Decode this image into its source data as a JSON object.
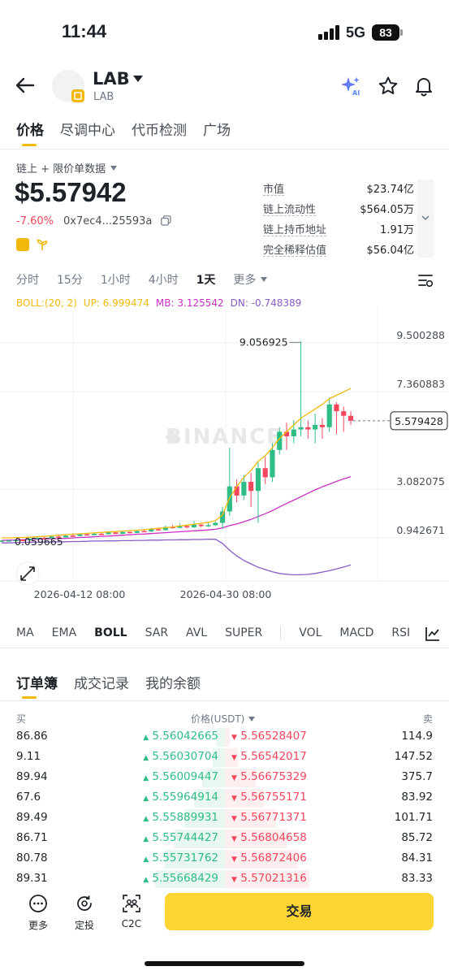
{
  "status": {
    "time": "11:44",
    "network": "5G",
    "battery": "83"
  },
  "token": {
    "name": "LAB",
    "subtitle": "LAB"
  },
  "tabs": [
    "价格",
    "尽调中心",
    "代币检测",
    "广场"
  ],
  "price_area": {
    "data_source": "链上 + 限价单数据",
    "price": "$5.57942",
    "change": "-7.60%",
    "address": "0x7ec4...25593a",
    "stats": [
      {
        "label": "市值",
        "value": "$23.74亿"
      },
      {
        "label": "链上流动性",
        "value": "$564.05万"
      },
      {
        "label": "链上持币地址",
        "value": "1.91万"
      },
      {
        "label": "完全稀释估值",
        "value": "$56.04亿"
      }
    ]
  },
  "intervals": [
    "分时",
    "15分",
    "1小时",
    "4小时",
    "1天",
    "更多"
  ],
  "boll": {
    "label": "BOLL:(20, 2)",
    "up": "UP: 6.999474",
    "mb": "MB: 3.125542",
    "dn": "DN: -0.748389"
  },
  "chart_data": {
    "type": "candlestick",
    "y_ticks": [
      "9.500288",
      "7.360883",
      "3.082075",
      "0.942671"
    ],
    "x_ticks": [
      "2026-04-12 08:00",
      "2026-04-30 08:00"
    ],
    "high_label": "9.056925",
    "low_label": "0.059665",
    "current_price_label": "5.579428",
    "watermark": "BINANCE",
    "ylim": [
      -1.2,
      10.5
    ],
    "candles": [
      {
        "o": 0.3,
        "c": 0.32,
        "h": 0.34,
        "l": 0.29
      },
      {
        "o": 0.32,
        "c": 0.33,
        "h": 0.36,
        "l": 0.3
      },
      {
        "o": 0.33,
        "c": 0.35,
        "h": 0.37,
        "l": 0.31
      },
      {
        "o": 0.35,
        "c": 0.34,
        "h": 0.38,
        "l": 0.32
      },
      {
        "o": 0.34,
        "c": 0.4,
        "h": 0.43,
        "l": 0.33
      },
      {
        "o": 0.4,
        "c": 0.44,
        "h": 0.48,
        "l": 0.38
      },
      {
        "o": 0.44,
        "c": 0.42,
        "h": 0.5,
        "l": 0.4
      },
      {
        "o": 0.42,
        "c": 0.5,
        "h": 0.54,
        "l": 0.41
      },
      {
        "o": 0.5,
        "c": 0.46,
        "h": 0.55,
        "l": 0.44
      },
      {
        "o": 0.46,
        "c": 0.54,
        "h": 0.58,
        "l": 0.45
      },
      {
        "o": 0.54,
        "c": 0.52,
        "h": 0.64,
        "l": 0.5
      },
      {
        "o": 0.52,
        "c": 0.6,
        "h": 0.64,
        "l": 0.51
      },
      {
        "o": 0.6,
        "c": 0.56,
        "h": 0.62,
        "l": 0.54
      },
      {
        "o": 0.56,
        "c": 0.62,
        "h": 0.66,
        "l": 0.55
      },
      {
        "o": 0.62,
        "c": 0.6,
        "h": 0.7,
        "l": 0.57
      },
      {
        "o": 0.6,
        "c": 0.68,
        "h": 0.72,
        "l": 0.59
      },
      {
        "o": 0.68,
        "c": 0.62,
        "h": 0.7,
        "l": 0.6
      },
      {
        "o": 0.62,
        "c": 0.7,
        "h": 0.74,
        "l": 0.61
      },
      {
        "o": 0.7,
        "c": 0.66,
        "h": 0.76,
        "l": 0.64
      },
      {
        "o": 0.66,
        "c": 0.74,
        "h": 0.78,
        "l": 0.65
      },
      {
        "o": 0.74,
        "c": 0.72,
        "h": 0.8,
        "l": 0.69
      },
      {
        "o": 0.72,
        "c": 0.82,
        "h": 0.88,
        "l": 0.7
      },
      {
        "o": 0.82,
        "c": 0.78,
        "h": 0.9,
        "l": 0.75
      },
      {
        "o": 0.78,
        "c": 0.92,
        "h": 0.98,
        "l": 0.77
      },
      {
        "o": 0.92,
        "c": 0.88,
        "h": 1.0,
        "l": 0.85
      },
      {
        "o": 0.88,
        "c": 0.96,
        "h": 1.08,
        "l": 0.86
      },
      {
        "o": 0.96,
        "c": 0.9,
        "h": 1.02,
        "l": 0.86
      },
      {
        "o": 0.9,
        "c": 1.02,
        "h": 1.18,
        "l": 0.88
      },
      {
        "o": 1.02,
        "c": 0.96,
        "h": 1.06,
        "l": 0.9
      },
      {
        "o": 0.96,
        "c": 1.0,
        "h": 1.1,
        "l": 0.92
      },
      {
        "o": 1.0,
        "c": 1.1,
        "h": 1.16,
        "l": 0.96
      },
      {
        "o": 1.1,
        "c": 1.6,
        "h": 1.8,
        "l": 0.86
      },
      {
        "o": 1.6,
        "c": 2.7,
        "h": 4.4,
        "l": 1.4
      },
      {
        "o": 2.7,
        "c": 2.3,
        "h": 3.0,
        "l": 2.0
      },
      {
        "o": 2.3,
        "c": 2.9,
        "h": 3.2,
        "l": 2.1
      },
      {
        "o": 2.9,
        "c": 2.5,
        "h": 3.3,
        "l": 1.8
      },
      {
        "o": 2.5,
        "c": 3.5,
        "h": 3.8,
        "l": 1.1
      },
      {
        "o": 3.5,
        "c": 3.1,
        "h": 4.0,
        "l": 2.8
      },
      {
        "o": 3.1,
        "c": 4.3,
        "h": 4.6,
        "l": 2.9
      },
      {
        "o": 4.3,
        "c": 5.1,
        "h": 5.3,
        "l": 4.1
      },
      {
        "o": 5.1,
        "c": 4.9,
        "h": 5.5,
        "l": 4.3
      },
      {
        "o": 4.9,
        "c": 5.2,
        "h": 5.6,
        "l": 4.6
      },
      {
        "o": 5.2,
        "c": 5.3,
        "h": 9.06,
        "l": 4.9
      },
      {
        "o": 5.3,
        "c": 5.2,
        "h": 5.6,
        "l": 4.8
      },
      {
        "o": 5.2,
        "c": 5.4,
        "h": 5.9,
        "l": 4.6
      },
      {
        "o": 5.4,
        "c": 5.3,
        "h": 5.7,
        "l": 4.8
      },
      {
        "o": 5.3,
        "c": 6.3,
        "h": 6.6,
        "l": 5.1
      },
      {
        "o": 6.3,
        "c": 6.0,
        "h": 6.4,
        "l": 5.0
      },
      {
        "o": 6.0,
        "c": 5.8,
        "h": 6.2,
        "l": 5.1
      },
      {
        "o": 5.8,
        "c": 5.58,
        "h": 6.0,
        "l": 5.4
      }
    ],
    "boll_up": [
      0.44,
      0.44,
      0.45,
      0.46,
      0.47,
      0.49,
      0.51,
      0.53,
      0.56,
      0.58,
      0.6,
      0.62,
      0.64,
      0.66,
      0.68,
      0.7,
      0.72,
      0.74,
      0.76,
      0.78,
      0.8,
      0.83,
      0.86,
      0.89,
      0.92,
      0.96,
      1.0,
      1.04,
      1.08,
      1.12,
      1.2,
      1.45,
      2.2,
      2.7,
      3.1,
      3.4,
      3.8,
      4.05,
      4.4,
      4.8,
      5.1,
      5.4,
      5.7,
      5.9,
      6.1,
      6.3,
      6.55,
      6.7,
      6.85,
      7.0
    ],
    "boll_mb": [
      0.33,
      0.34,
      0.35,
      0.36,
      0.37,
      0.38,
      0.39,
      0.4,
      0.41,
      0.42,
      0.44,
      0.46,
      0.47,
      0.49,
      0.51,
      0.52,
      0.54,
      0.56,
      0.58,
      0.6,
      0.61,
      0.63,
      0.65,
      0.67,
      0.69,
      0.71,
      0.73,
      0.75,
      0.77,
      0.79,
      0.82,
      0.88,
      0.98,
      1.05,
      1.15,
      1.25,
      1.38,
      1.5,
      1.64,
      1.8,
      1.95,
      2.1,
      2.25,
      2.4,
      2.55,
      2.68,
      2.8,
      2.92,
      3.03,
      3.13
    ],
    "boll_dn": [
      0.22,
      0.22,
      0.23,
      0.24,
      0.25,
      0.25,
      0.26,
      0.26,
      0.27,
      0.27,
      0.28,
      0.28,
      0.29,
      0.3,
      0.3,
      0.31,
      0.31,
      0.32,
      0.32,
      0.33,
      0.33,
      0.34,
      0.34,
      0.35,
      0.35,
      0.36,
      0.36,
      0.37,
      0.37,
      0.38,
      0.38,
      0.2,
      -0.1,
      -0.35,
      -0.55,
      -0.7,
      -0.85,
      -0.95,
      -1.05,
      -1.12,
      -1.16,
      -1.18,
      -1.18,
      -1.16,
      -1.12,
      -1.06,
      -1.0,
      -0.92,
      -0.84,
      -0.75
    ]
  },
  "indicators": [
    "MA",
    "EMA",
    "BOLL",
    "SAR",
    "AVL",
    "SUPER",
    "VOL",
    "MACD",
    "RSI"
  ],
  "orderbook": {
    "tabs": [
      "订单簿",
      "成交记录",
      "我的余额"
    ],
    "head_buy": "买",
    "head_price": "价格(USDT)",
    "head_sell": "卖",
    "rows": [
      {
        "bid_qty": "86.86",
        "bid": "5.56042665",
        "ask": "5.56528407",
        "ask_qty": "114.9",
        "bid_w": 0.1,
        "ask_w": 0.05
      },
      {
        "bid_qty": "9.11",
        "bid": "5.56030704",
        "ask": "5.56542017",
        "ask_qty": "147.52",
        "bid_w": 0.15,
        "ask_w": 0.14
      },
      {
        "bid_qty": "89.94",
        "bid": "5.56009447",
        "ask": "5.56675329",
        "ask_qty": "375.7",
        "bid_w": 0.28,
        "ask_w": 0.33
      },
      {
        "bid_qty": "67.6",
        "bid": "5.55964914",
        "ask": "5.56755171",
        "ask_qty": "83.92",
        "bid_w": 0.38,
        "ask_w": 0.42
      },
      {
        "bid_qty": "89.49",
        "bid": "5.55889931",
        "ask": "5.56771371",
        "ask_qty": "101.71",
        "bid_w": 0.5,
        "ask_w": 0.55
      },
      {
        "bid_qty": "86.71",
        "bid": "5.55744427",
        "ask": "5.56804658",
        "ask_qty": "85.72",
        "bid_w": 0.62,
        "ask_w": 0.66
      },
      {
        "bid_qty": "80.78",
        "bid": "5.55731762",
        "ask": "5.56872406",
        "ask_qty": "84.31",
        "bid_w": 0.74,
        "ask_w": 0.78
      },
      {
        "bid_qty": "89.31",
        "bid": "5.55668429",
        "ask": "5.57021316",
        "ask_qty": "83.33",
        "bid_w": 0.86,
        "ask_w": 0.9
      }
    ]
  },
  "bottom": {
    "more": "更多",
    "invest": "定投",
    "c2c": "C2C",
    "trade": "交易"
  },
  "colors": {
    "up": "#2ebd85",
    "down": "#f6465d",
    "accent": "#f0b90b",
    "boll_up": "#f0b90b",
    "boll_mb": "#c92ec5",
    "boll_dn": "#8a5cc4"
  }
}
